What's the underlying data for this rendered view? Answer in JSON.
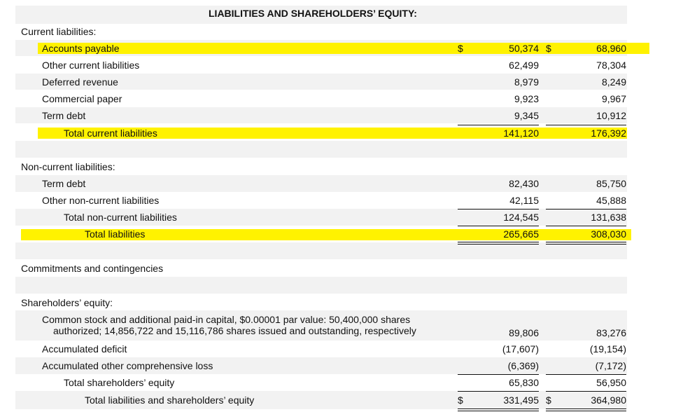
{
  "header": {
    "title": "LIABILITIES AND SHAREHOLDERS’ EQUITY:"
  },
  "currency": "$",
  "current": {
    "heading": "Current liabilities:",
    "rows": [
      {
        "label": "Accounts payable",
        "v1": "50,374",
        "v2": "68,960"
      },
      {
        "label": "Other current liabilities",
        "v1": "62,499",
        "v2": "78,304"
      },
      {
        "label": "Deferred revenue",
        "v1": "8,979",
        "v2": "8,249"
      },
      {
        "label": "Commercial paper",
        "v1": "9,923",
        "v2": "9,967"
      },
      {
        "label": "Term debt",
        "v1": "9,345",
        "v2": "10,912"
      }
    ],
    "total": {
      "label": "Total current liabilities",
      "v1": "141,120",
      "v2": "176,392"
    }
  },
  "noncurrent": {
    "heading": "Non-current liabilities:",
    "rows": [
      {
        "label": "Term debt",
        "v1": "82,430",
        "v2": "85,750"
      },
      {
        "label": "Other non-current liabilities",
        "v1": "42,115",
        "v2": "45,888"
      }
    ],
    "total": {
      "label": "Total non-current liabilities",
      "v1": "124,545",
      "v2": "131,638"
    },
    "total_liabilities": {
      "label": "Total liabilities",
      "v1": "265,665",
      "v2": "308,030"
    }
  },
  "commitments": {
    "label": "Commitments and contingencies"
  },
  "equity": {
    "heading": "Shareholders’ equity:",
    "common_stock": {
      "line1": "Common stock and additional paid-in capital, $0.00001 par value: 50,400,000 shares",
      "line2": "authorized; 14,856,722 and 15,116,786 shares issued and outstanding, respectively",
      "v1": "89,806",
      "v2": "83,276"
    },
    "rows": [
      {
        "label": "Accumulated deficit",
        "v1": "(17,607)",
        "v2": "(19,154)"
      },
      {
        "label": "Accumulated other comprehensive loss",
        "v1": "(6,369)",
        "v2": "(7,172)"
      }
    ],
    "total": {
      "label": "Total shareholders’ equity",
      "v1": "65,830",
      "v2": "56,950"
    },
    "grand_total": {
      "label": "Total liabilities and shareholders’ equity",
      "v1": "331,495",
      "v2": "364,980"
    }
  },
  "highlight_color": "#fff200"
}
